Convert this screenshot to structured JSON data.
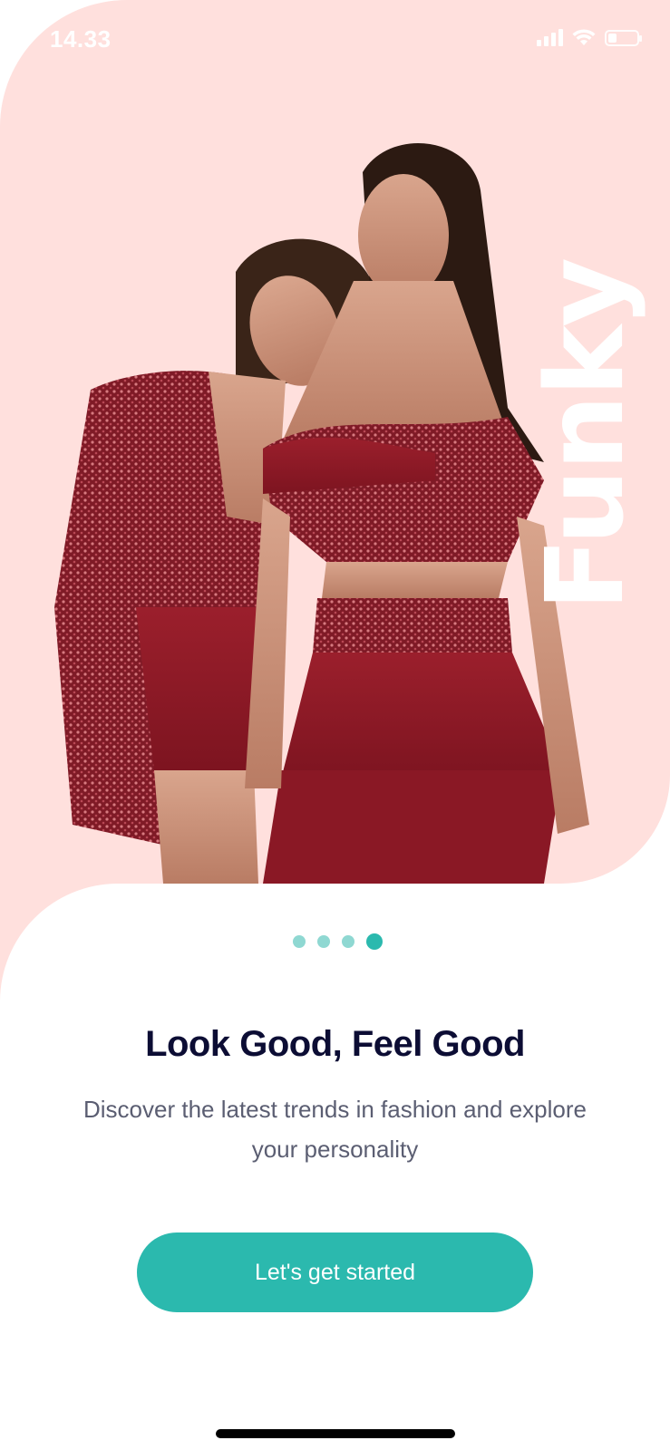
{
  "status_bar": {
    "time": "14.33"
  },
  "hero": {
    "word": "Funky",
    "background_color": "#ffe0dd",
    "image_icon": "fashion-models-photo"
  },
  "pager": {
    "total": 4,
    "active_index": 3
  },
  "content": {
    "title": "Look Good, Feel Good",
    "subtitle": "Discover the latest trends in fashion and explore your personality"
  },
  "cta": {
    "label": "Let's get started",
    "color": "#2bb9ae"
  }
}
